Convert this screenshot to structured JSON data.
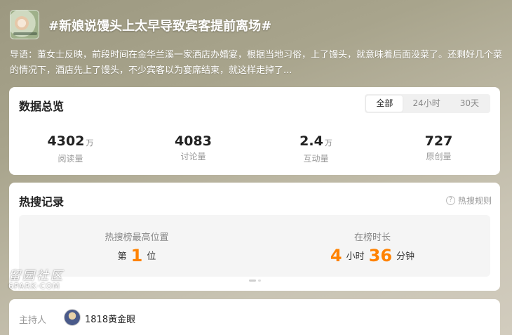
{
  "topic": {
    "title": "#新娘说馒头上太早导致宾客提前离场#",
    "intro": "导语：董女士反映，前段时间在金华兰溪一家酒店办婚宴，根据当地习俗，上了馒头，就意味着后面没菜了。还剩好几个菜的情况下，酒店先上了馒头，不少宾客以为宴席结束，就这样走掉了..."
  },
  "overview": {
    "title": "数据总览",
    "tabs": [
      "全部",
      "24小时",
      "30天"
    ],
    "active_tab": "全部",
    "stats": [
      {
        "value": "4302",
        "unit": "万",
        "label": "阅读量"
      },
      {
        "value": "4083",
        "unit": "",
        "label": "讨论量"
      },
      {
        "value": "2.4",
        "unit": "万",
        "label": "互动量"
      },
      {
        "value": "727",
        "unit": "",
        "label": "原创量"
      }
    ]
  },
  "hot": {
    "title": "热搜记录",
    "rules_label": "热搜规则",
    "rules_icon": "question-circle-icon",
    "peak_label": "热搜榜最高位置",
    "peak_prefix": "第",
    "peak_value": "1",
    "peak_suffix": "位",
    "duration_label": "在榜时长",
    "duration_hours": "4",
    "hours_unit": "小时",
    "duration_minutes": "36",
    "minutes_unit": "分钟",
    "accent_color": "#ff8200"
  },
  "host": {
    "label": "主持人",
    "name": "1818黄金眼"
  },
  "watermark": {
    "cn": "留园社区",
    "en": "6PARK·COM"
  }
}
